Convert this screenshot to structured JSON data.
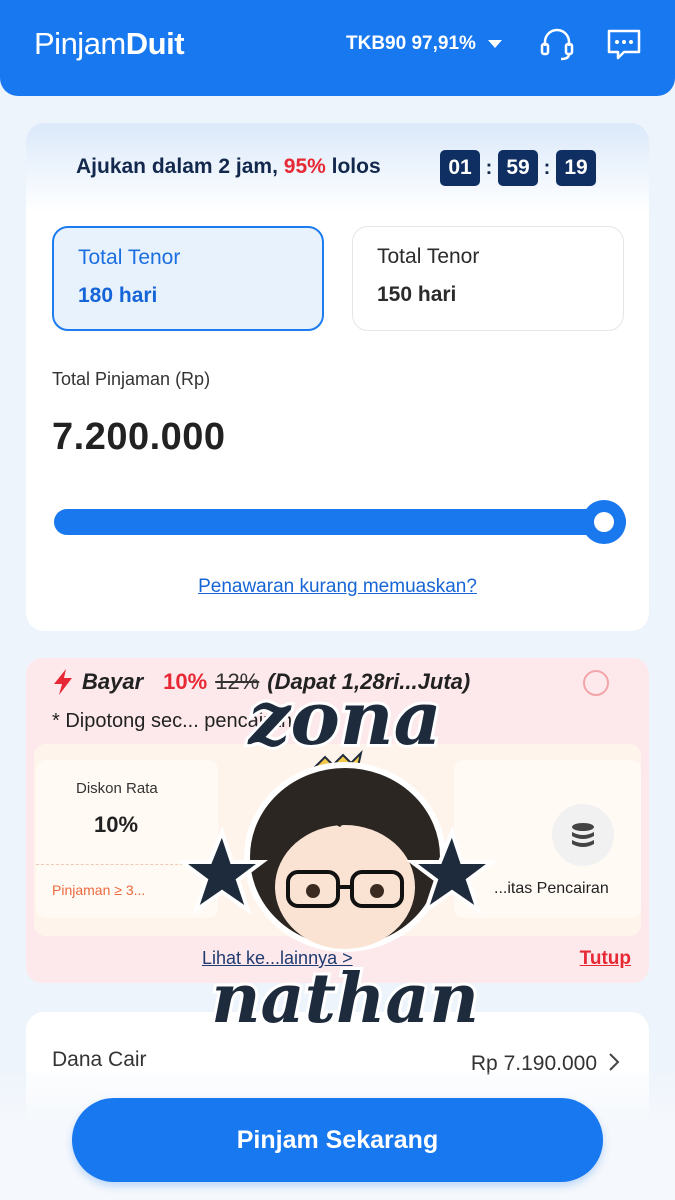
{
  "header": {
    "logo_part1": "Pinjam",
    "logo_part2": "Duit",
    "tkb_label": "TKB90 97,91%",
    "support_icon": "headset-icon",
    "message_icon": "chat-icon"
  },
  "offer": {
    "promo_prefix": "Ajukan dalam 2 jam,",
    "promo_pct": "95%",
    "promo_suffix": "lolos",
    "timer": {
      "h": "01",
      "m": "59",
      "s": "19"
    }
  },
  "tenor": [
    {
      "label": "Total Tenor",
      "value": "180 hari",
      "selected": true
    },
    {
      "label": "Total Tenor",
      "value": "150 hari",
      "selected": false
    }
  ],
  "loan": {
    "label": "Total Pinjaman (Rp)",
    "amount": "7.200.000",
    "slider_fraction": 1.0,
    "offer_link": "Penawaran kurang memuaskan?"
  },
  "promo": {
    "title": "Bayar",
    "pct_new": "10%",
    "pct_old": "12%",
    "dapat": "(Dapat 1,28ri...Juta)",
    "note": "* Dipotong sec... pencairan",
    "benefit1": {
      "label": "Diskon Rata",
      "value": "10%",
      "foot": "Pinjaman ≥ 3..."
    },
    "benefit2": {
      "label": "...itas Pencairan"
    },
    "see_more": "Lihat ke...lainnya >",
    "close": "Tutup"
  },
  "dana": {
    "label": "Dana Cair",
    "value": "Rp 7.190.000"
  },
  "cta": {
    "label": "Pinjam Sekarang"
  },
  "watermark": {
    "line1": "zona",
    "line2": "nathan"
  },
  "colors": {
    "primary": "#1878ef",
    "accent_red": "#e62935",
    "navy": "#0f2f63",
    "promo_bg": "#fde9eb"
  }
}
